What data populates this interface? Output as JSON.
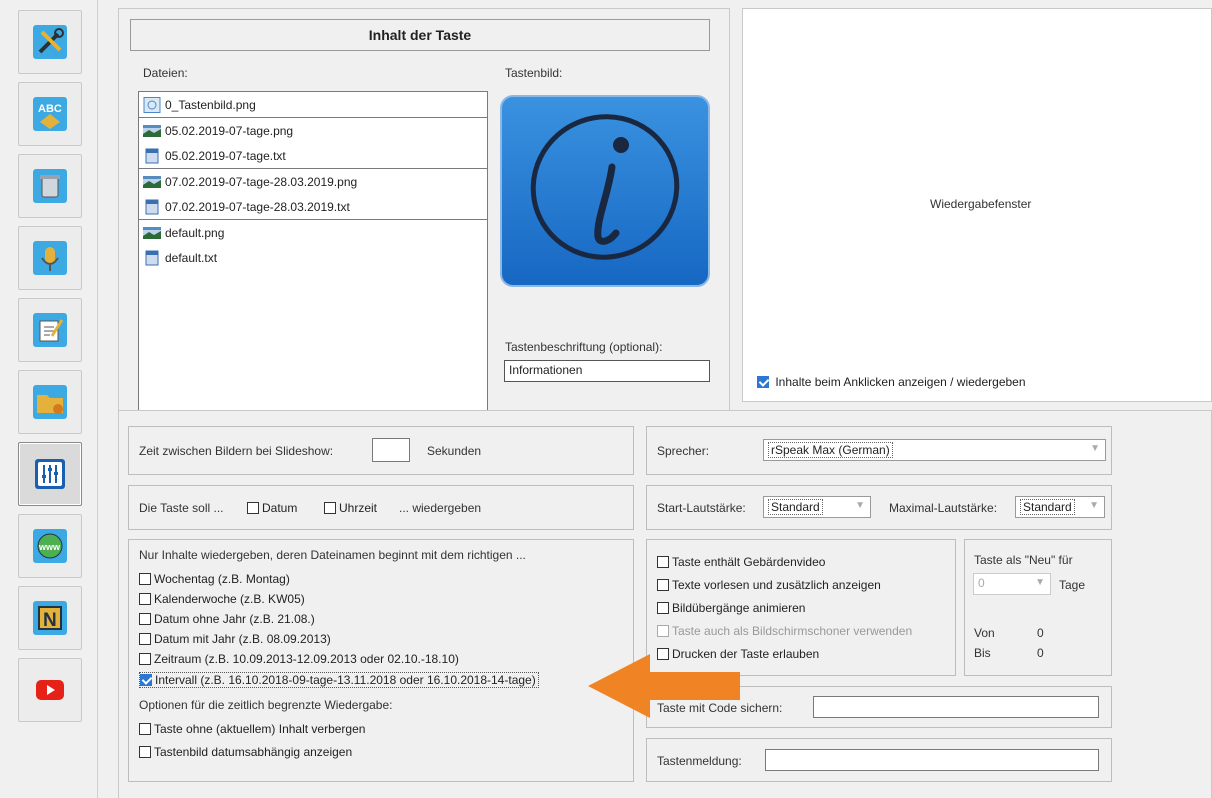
{
  "toolbar": {
    "items": [
      {
        "name": "tools-icon"
      },
      {
        "name": "abc-icon"
      },
      {
        "name": "trash-icon"
      },
      {
        "name": "microphone-icon"
      },
      {
        "name": "edit-icon"
      },
      {
        "name": "folder-icon"
      },
      {
        "name": "equalizer-icon",
        "active": true
      },
      {
        "name": "www-icon"
      },
      {
        "name": "n-icon"
      },
      {
        "name": "youtube-icon"
      }
    ]
  },
  "content": {
    "title": "Inhalt der Taste",
    "files_label": "Dateien:",
    "files_groups": [
      [
        {
          "name": "0_Tastenbild.png",
          "type": "image-small"
        }
      ],
      [
        {
          "name": "05.02.2019-07-tage.png",
          "type": "image"
        },
        {
          "name": "05.02.2019-07-tage.txt",
          "type": "text"
        }
      ],
      [
        {
          "name": "07.02.2019-07-tage-28.03.2019.png",
          "type": "image"
        },
        {
          "name": "07.02.2019-07-tage-28.03.2019.txt",
          "type": "text"
        }
      ],
      [
        {
          "name": "default.png",
          "type": "image"
        },
        {
          "name": "default.txt",
          "type": "text"
        }
      ]
    ],
    "image_label": "Tastenbild:",
    "caption_label": "Tastenbeschriftung (optional):",
    "caption_value": "Informationen"
  },
  "playback": {
    "window_label": "Wiedergabefenster",
    "show_on_click": "Inhalte beim Anklicken anzeigen / wiedergeben"
  },
  "slideshow": {
    "label": "Zeit zwischen Bildern bei Slideshow:",
    "value": "",
    "unit": "Sekunden"
  },
  "show": {
    "prefix": "Die Taste soll ...",
    "date": "Datum",
    "time": "Uhrzeit",
    "suffix": "... wiedergeben"
  },
  "filename_filter": {
    "heading": "Nur Inhalte wiedergeben, deren Dateinamen beginnt mit dem richtigen ...",
    "options": [
      {
        "label": "Wochentag (z.B. Montag)",
        "checked": false
      },
      {
        "label": "Kalenderwoche (z.B. KW05)",
        "checked": false
      },
      {
        "label": "Datum ohne Jahr (z.B. 21.08.)",
        "checked": false
      },
      {
        "label": "Datum mit Jahr (z.B. 08.09.2013)",
        "checked": false
      },
      {
        "label": "Zeitraum (z.B. 10.09.2013-12.09.2013 oder 02.10.-18.10)",
        "checked": false
      },
      {
        "label": "Intervall (z.B. 16.10.2018-09-tage-13.11.2018 oder 16.10.2018-14-tage)",
        "checked": true
      }
    ],
    "options_heading": "Optionen für die zeitlich begrenzte Wiedergabe:",
    "limited_options": [
      {
        "label": "Taste ohne (aktuellem) Inhalt verbergen",
        "checked": false
      },
      {
        "label": "Tastenbild datumsabhängig anzeigen",
        "checked": false
      }
    ]
  },
  "speaker": {
    "label": "Sprecher:",
    "value": "rSpeak Max (German)"
  },
  "volume": {
    "start_label": "Start-Lautstärke:",
    "start_value": "Standard",
    "max_label": "Maximal-Lautstärke:",
    "max_value": "Standard"
  },
  "key_options": [
    {
      "label": "Taste enthält Gebärdenvideo",
      "checked": false,
      "disabled": false
    },
    {
      "label": "Texte vorlesen und zusätzlich anzeigen",
      "checked": false,
      "disabled": false
    },
    {
      "label": "Bildübergänge animieren",
      "checked": false,
      "disabled": false
    },
    {
      "label": "Taste auch als Bildschirmschoner verwenden",
      "checked": false,
      "disabled": true
    },
    {
      "label": "Drucken der Taste erlauben",
      "checked": false,
      "disabled": false
    }
  ],
  "new_box": {
    "label": "Taste als \"Neu\" für",
    "value": "0",
    "unit": "Tage",
    "from_label": "Von",
    "from_value": "0",
    "to_label": "Bis",
    "to_value": "0"
  },
  "secure": {
    "label": "Taste mit Code sichern:",
    "value": ""
  },
  "message": {
    "label": "Tastenmeldung:",
    "value": ""
  },
  "colors": {
    "accent": "#2a78d4",
    "arrow": "#f08424",
    "info_tile": "#1f7ad2"
  }
}
